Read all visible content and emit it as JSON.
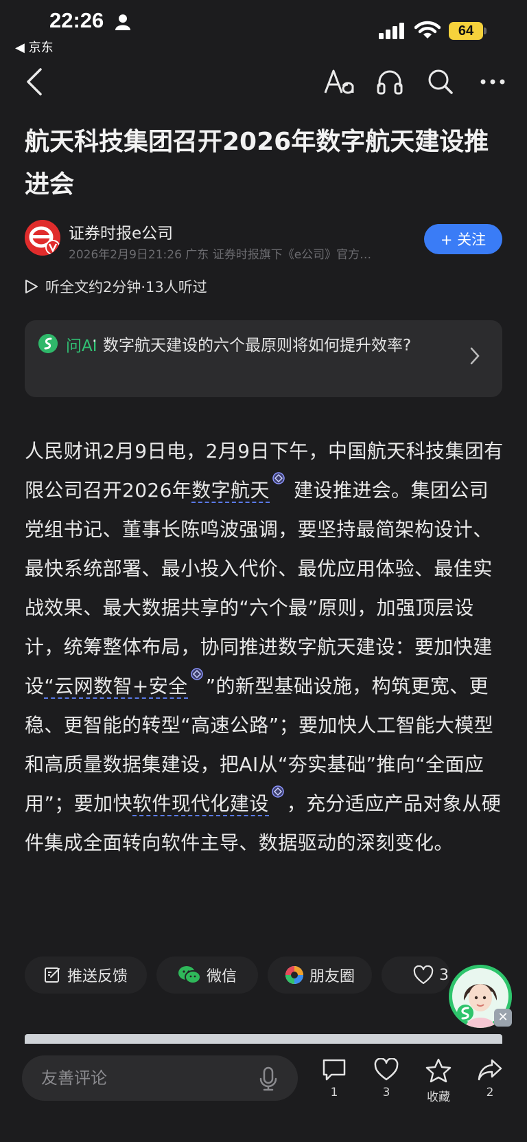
{
  "status_bar": {
    "time": "22:26",
    "back_app": "◀ 京东",
    "battery": "64"
  },
  "article": {
    "title": "航天科技集团召开2026年数字航天建设推进会",
    "author": {
      "name": "证券时报e公司",
      "meta": "2026年2月9日21:26 广东 证券时报旗下《e公司》官方…"
    },
    "follow_label": "+ 关注",
    "listen_text": "听全文约2分钟·13人听过",
    "ai": {
      "label": "问AI",
      "dot": "·",
      "question": "数字航天建设的六个最原则将如何提升效率?"
    },
    "body": {
      "p1": "人民财讯2月9日电，2月9日下午，中国航天科技集团有限公司召开2026年",
      "kw1": "数字航天",
      "p2": " 建设推进会。集团公司党组书记、董事长陈鸣波强调，要坚持最简架构设计、最快系统部署、最小投入代价、最优应用体验、最佳实战效果、最大数据共享的“六个最”原则，加强顶层设计，统筹整体布局，协同推进数字航天建设：要加快建设",
      "kw2": "“云网数智+安全",
      "p3": "”的新型基础设施，构筑更宽、更稳、更智能的转型“高速公路”；要加快人工智能大模型和高质量数据集建设，把AI从“夯实基础”推向“全面应用”；要加快",
      "kw3": "软件现代化建设",
      "p4": "，充分适应产品对象从硬件集成全面转向软件主导、数据驱动的深刻变化。"
    }
  },
  "share": {
    "feedback": "推送反馈",
    "wechat": "微信",
    "moments": "朋友圈",
    "likes": "3"
  },
  "bottom_bar": {
    "comment_placeholder": "友善评论",
    "comments": "1",
    "likes": "3",
    "favorite": "收藏",
    "shares": "2"
  }
}
